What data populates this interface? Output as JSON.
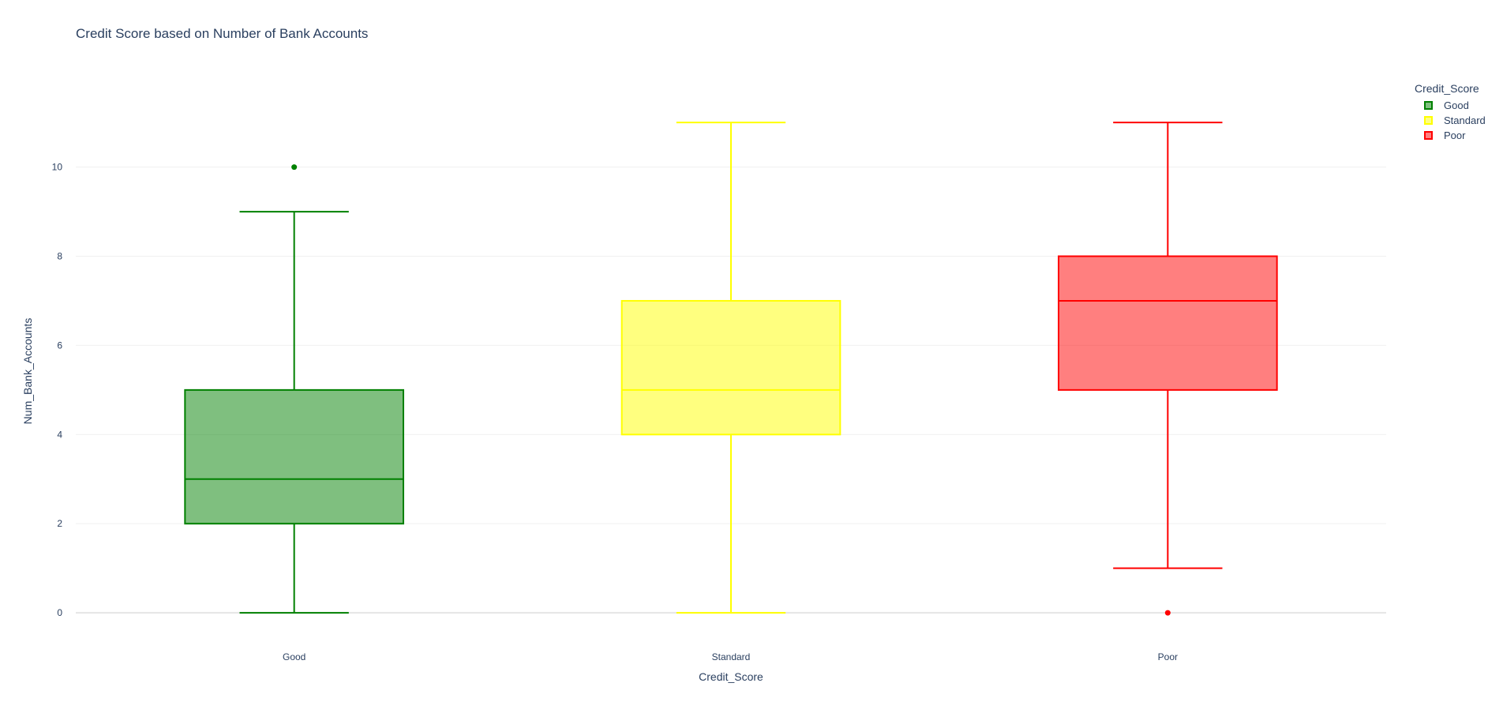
{
  "chart_data": {
    "type": "box",
    "title": "Credit Score based on Number of Bank Accounts",
    "xlabel": "Credit_Score",
    "ylabel": "Num_Bank_Accounts",
    "categories": [
      "Good",
      "Standard",
      "Poor"
    ],
    "y_ticks": [
      0,
      2,
      4,
      6,
      8,
      10
    ],
    "y_tick_labels": [
      "0",
      "2",
      "4",
      "6",
      "8",
      "10"
    ],
    "ylim": [
      -0.6,
      11.8
    ],
    "grid": true,
    "legend": {
      "title": "Credit_Score",
      "placement": "top-right",
      "items": [
        "Good",
        "Standard",
        "Poor"
      ]
    },
    "series": [
      {
        "name": "Good",
        "color": "#008000",
        "fill": "rgba(0,128,0,0.5)",
        "min": 0,
        "q1": 2,
        "median": 3,
        "q3": 5,
        "max": 9,
        "outliers": [
          10
        ]
      },
      {
        "name": "Standard",
        "color": "#ffff00",
        "fill": "rgba(255,255,0,0.5)",
        "min": 0,
        "q1": 4,
        "median": 5,
        "q3": 7,
        "max": 11,
        "outliers": []
      },
      {
        "name": "Poor",
        "color": "#ff0000",
        "fill": "rgba(255,0,0,0.5)",
        "min": 1,
        "q1": 5,
        "median": 7,
        "q3": 8,
        "max": 11,
        "outliers": [
          0
        ]
      }
    ]
  }
}
